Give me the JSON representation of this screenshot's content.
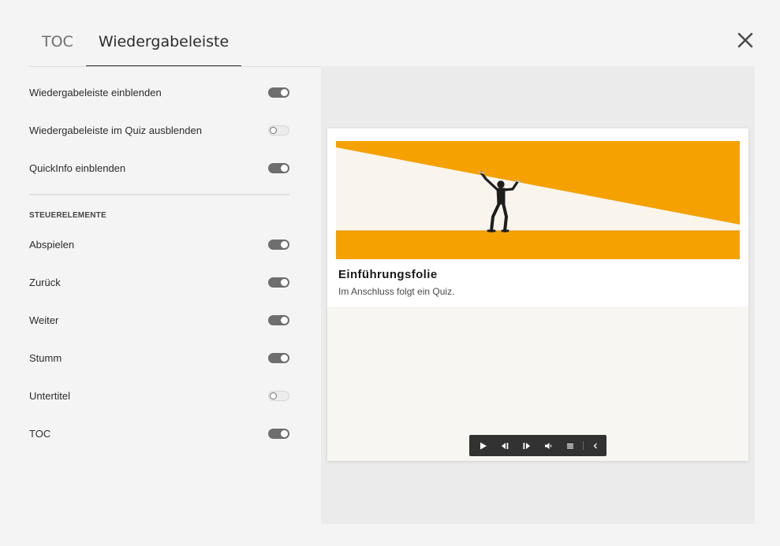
{
  "tabs": [
    {
      "label": "TOC",
      "active": false
    },
    {
      "label": "Wiedergabeleiste",
      "active": true
    }
  ],
  "settings": {
    "general": [
      {
        "label": "Wiedergabeleiste einblenden",
        "on": true
      },
      {
        "label": "Wiedergabeleiste im Quiz ausblenden",
        "on": false
      },
      {
        "label": "QuickInfo einblenden",
        "on": true
      }
    ],
    "section_title": "STEUERELEMENTE",
    "controls": [
      {
        "label": "Abspielen",
        "on": true
      },
      {
        "label": "Zurück",
        "on": true
      },
      {
        "label": "Weiter",
        "on": true
      },
      {
        "label": "Stumm",
        "on": true
      },
      {
        "label": "Untertitel",
        "on": false
      },
      {
        "label": "TOC",
        "on": true
      }
    ]
  },
  "preview": {
    "slide_title": "Einführungsfolie",
    "slide_subtitle": "Im Anschluss folgt ein Quiz.",
    "playbar_buttons": [
      "play-icon",
      "rewind-icon",
      "forward-icon",
      "mute-icon",
      "toc-icon",
      "collapse-icon"
    ]
  },
  "colors": {
    "accent_orange": "#f5a100",
    "toggle_on": "#6e6e6e",
    "playbar": "#323232"
  }
}
